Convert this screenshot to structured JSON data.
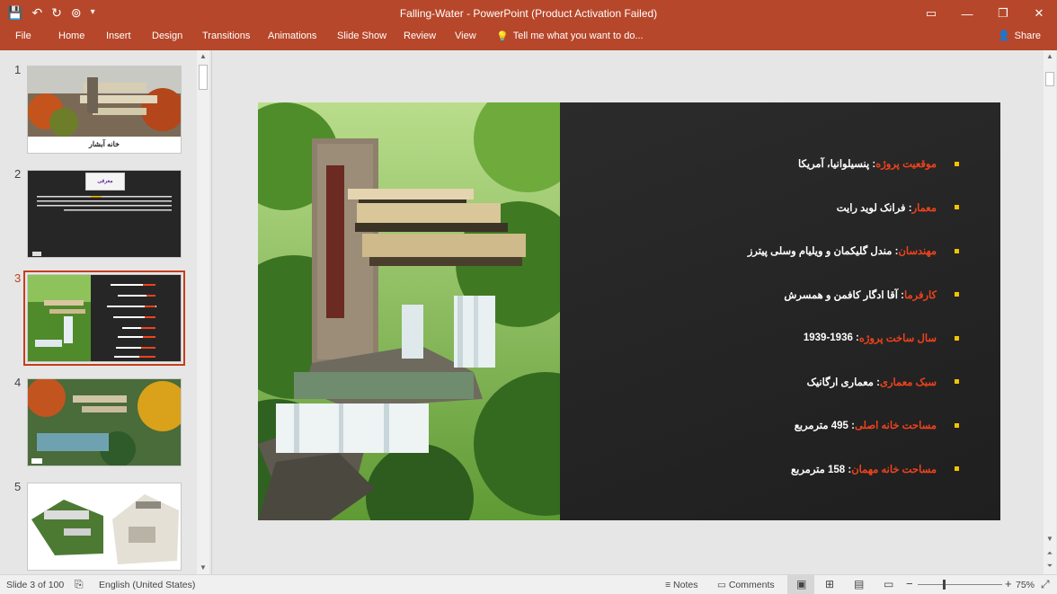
{
  "titlebar": {
    "title": "Falling-Water - PowerPoint (Product Activation Failed)",
    "save_icon": "💾",
    "undo_icon": "↶",
    "redo_icon": "↻",
    "present_icon": "⊚",
    "customize_icon": "▾",
    "ribbon_display_icon": "▭",
    "minimize_icon": "—",
    "restore_icon": "❐",
    "close_icon": "✕"
  },
  "ribbon": {
    "tabs": [
      "File",
      "Home",
      "Insert",
      "Design",
      "Transitions",
      "Animations",
      "Slide Show",
      "Review",
      "View"
    ],
    "tellme": "Tell me what you want to do...",
    "tellme_icon": "💡",
    "share": "Share",
    "share_icon": "👤"
  },
  "thumbnails": {
    "numbers": [
      "1",
      "2",
      "3",
      "4",
      "5"
    ],
    "slide1_caption": "خانه آبشار",
    "slide2_title": "معرفی",
    "active": 3
  },
  "slide": {
    "bullets": [
      {
        "label": "موقعیت پروژه",
        "value": ": پنسیلوانیا، آمریکا"
      },
      {
        "label": "معمار",
        "value": ": فرانک لوید رایت"
      },
      {
        "label": "مهندسان",
        "value": ": مندل گلیکمان و ویلیام وسلی پیترز"
      },
      {
        "label": "کارفرما",
        "value": ": آقا ادگار کافمن و همسرش"
      },
      {
        "label": "سال ساخت پروژه",
        "value": ": 1939-1936"
      },
      {
        "label": "سبک معماری",
        "value": " : معماری ارگانیک"
      },
      {
        "label": "مساحت خانه اصلی",
        "value": " : 495 مترمربع"
      },
      {
        "label": "مساحت خانه مهمان",
        "value": " : 158 مترمربع"
      }
    ]
  },
  "status": {
    "slide_of": "Slide 3 of 100",
    "language": "English (United States)",
    "notes": "Notes",
    "comments": "Comments",
    "zoom_minus": "−",
    "zoom_plus": "+",
    "zoom": "75%"
  }
}
